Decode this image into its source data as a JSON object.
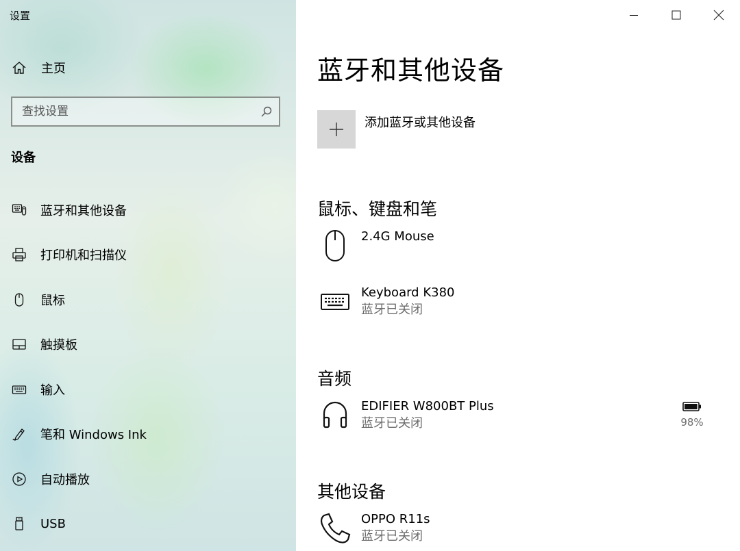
{
  "app_title": "设置",
  "sidebar": {
    "home_label": "主页",
    "search_placeholder": "查找设置",
    "section_title": "设备",
    "items": [
      {
        "label": "蓝牙和其他设备",
        "icon": "bluetooth-devices-icon"
      },
      {
        "label": "打印机和扫描仪",
        "icon": "printer-icon"
      },
      {
        "label": "鼠标",
        "icon": "mouse-icon"
      },
      {
        "label": "触摸板",
        "icon": "touchpad-icon"
      },
      {
        "label": "输入",
        "icon": "keyboard-icon"
      },
      {
        "label": "笔和 Windows Ink",
        "icon": "pen-icon"
      },
      {
        "label": "自动播放",
        "icon": "autoplay-icon"
      },
      {
        "label": "USB",
        "icon": "usb-icon"
      }
    ]
  },
  "main": {
    "title": "蓝牙和其他设备",
    "add_device_label": "添加蓝牙或其他设备",
    "groups": [
      {
        "title": "鼠标、键盘和笔",
        "devices": [
          {
            "name": "2.4G Mouse",
            "status": "",
            "icon": "mouse-icon"
          },
          {
            "name": "Keyboard K380",
            "status": "蓝牙已关闭",
            "icon": "keyboard-icon"
          }
        ]
      },
      {
        "title": "音频",
        "devices": [
          {
            "name": "EDIFIER W800BT Plus",
            "status": "蓝牙已关闭",
            "icon": "headphones-icon",
            "battery": "98%",
            "battery_level": 0.98
          }
        ]
      },
      {
        "title": "其他设备",
        "devices": [
          {
            "name": "OPPO R11s",
            "status": "蓝牙已关闭",
            "icon": "phone-icon"
          }
        ]
      }
    ]
  },
  "colors": {
    "secondary_text": "#6b6b6b",
    "add_tile_bg": "#d7d7d7",
    "search_border": "#8a8f8b"
  }
}
